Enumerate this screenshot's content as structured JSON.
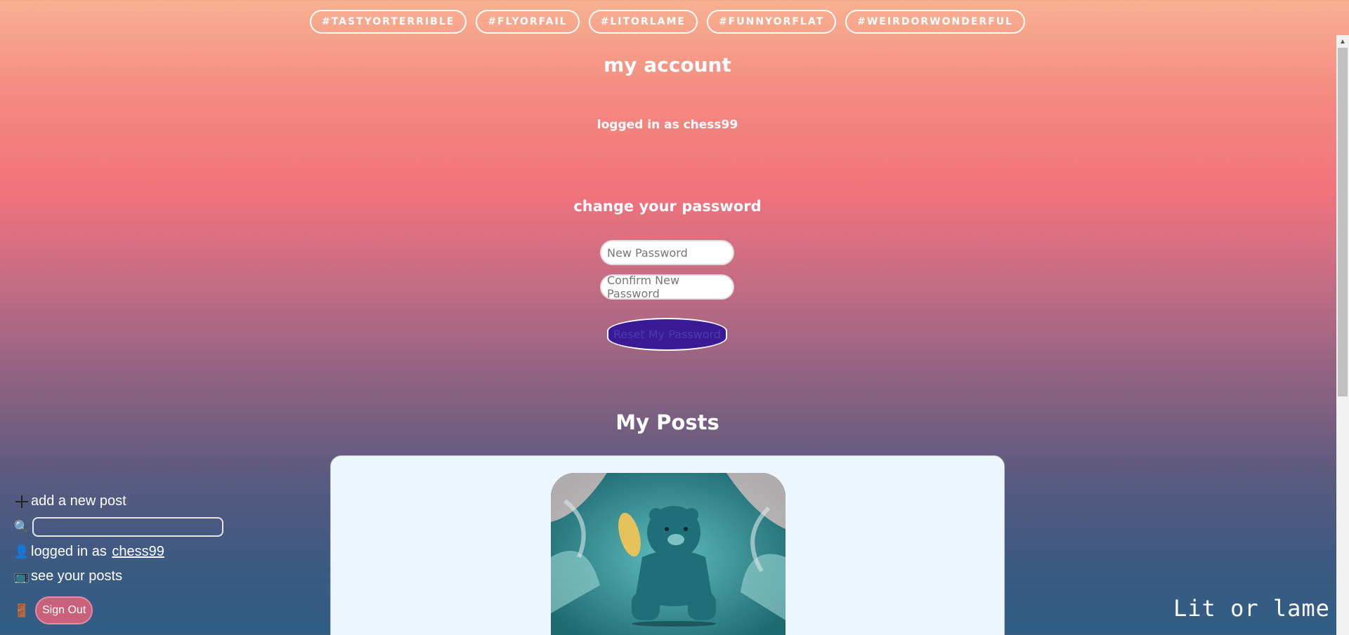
{
  "tags": [
    "#TASTYORTERRIBLE",
    "#FLYORFAIL",
    "#LITORLAME",
    "#FUNNYORFLAT",
    "#WEIRDORWONDERFUL"
  ],
  "account": {
    "title": "my account",
    "logged_in": "logged in as chess99"
  },
  "password": {
    "title": "change your password",
    "new_placeholder": "New Password",
    "confirm_placeholder": "Confirm New Password",
    "reset_label": "Reset My Password"
  },
  "posts": {
    "title": "My Posts"
  },
  "sidebar": {
    "add_post": "add a new post",
    "logged_prefix": "logged in as ",
    "username": "chess99",
    "see_posts": "see your posts",
    "sign_out": "Sign Out"
  },
  "brand": "Lit or lame",
  "icons": {
    "plus": "plus-icon",
    "search": "magnifier-icon",
    "user": "user-icon",
    "tv": "tv-icon",
    "door": "door-icon"
  }
}
